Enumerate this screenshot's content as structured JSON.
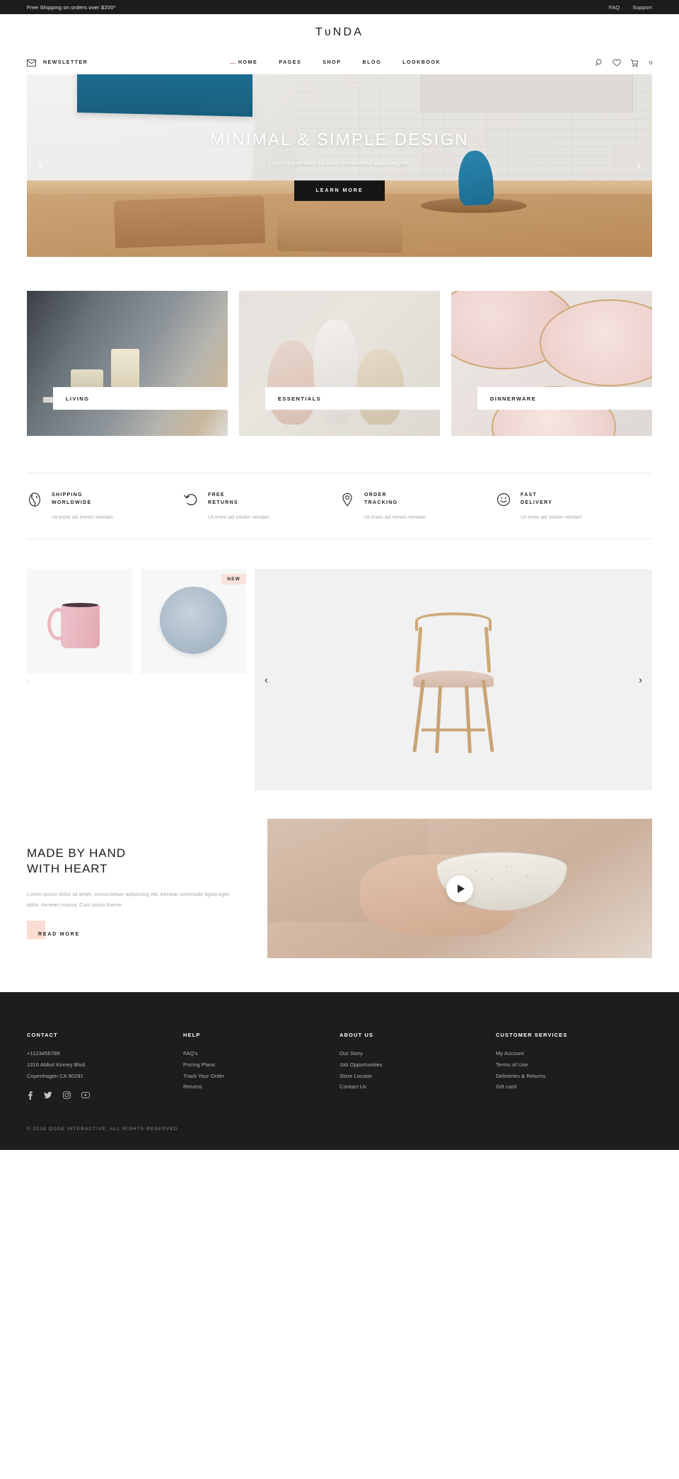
{
  "topbar": {
    "promo": "Free Shipping on orders over $200*",
    "links": [
      "FAQ",
      "Support"
    ]
  },
  "brand": {
    "logo": "TᴜNDA"
  },
  "nav": {
    "newsletter_label": "NEWSLETTER",
    "items": [
      {
        "label": "HOME",
        "active": true
      },
      {
        "label": "PAGES",
        "active": false
      },
      {
        "label": "SHOP",
        "active": false
      },
      {
        "label": "BLOG",
        "active": false
      },
      {
        "label": "LOOKBOOK",
        "active": false
      }
    ],
    "cart_count": "0"
  },
  "hero": {
    "title": "MINIMAL &\nSIMPLE DESIGN",
    "subtitle": "Lorem ipsum dolor sit amet, consectetur adipiscing elit.",
    "cta": "LEARN MORE",
    "prev": "‹",
    "next": "›"
  },
  "categories": [
    {
      "label": "LIVING"
    },
    {
      "label": "ESSENTIALS"
    },
    {
      "label": "DINNERWARE"
    }
  ],
  "services": [
    {
      "icon": "globe-icon",
      "title": "SHIPPING\nWORLDWIDE",
      "desc": "Ut enim ad minim veniam"
    },
    {
      "icon": "return-arrow-icon",
      "title": "FREE\nRETURNS",
      "desc": "Ut enim ad minim veniam"
    },
    {
      "icon": "map-pin-icon",
      "title": "ORDER\nTRACKING",
      "desc": "Ut enim ad minim veniam"
    },
    {
      "icon": "smiley-icon",
      "title": "FAST\nDELIVERY",
      "desc": "Ut enim ad minim veniam"
    }
  ],
  "products": {
    "badge_new": "NEW",
    "stray_text": "y",
    "carousel_prev": "‹",
    "carousel_next": "›"
  },
  "about": {
    "title": "MADE BY HAND\nWITH HEART",
    "desc": "Lorem ipsum dolor sit amet, consectetuer adipiscing elit. Aenean commodo ligula eget dolor. Aenean massa. Cum sociis theme.",
    "cta": "READ MORE"
  },
  "footer": {
    "columns": [
      {
        "heading": "CONTACT",
        "lines": [
          "+1123456789",
          "1316 Abbot Kinney Blvd.",
          "Copenhagen CA 90291"
        ],
        "links": []
      },
      {
        "heading": "HELP",
        "lines": [],
        "links": [
          "FAQ's",
          "Pricing Plans",
          "Track Your Order",
          "Returns"
        ]
      },
      {
        "heading": "ABOUT US",
        "lines": [],
        "links": [
          "Our Story",
          "Job Opportunities",
          "Store Locator",
          "Contact Us"
        ]
      },
      {
        "heading": "CUSTOMER SERVICES",
        "lines": [],
        "links": [
          "My Account",
          "Terms of Use",
          "Deliveries & Returns",
          "Gift card"
        ]
      }
    ],
    "socials": [
      "facebook-icon",
      "twitter-icon",
      "instagram-icon",
      "youtube-icon"
    ],
    "copyright": "© 2018 QODE INTERACTIVE, ALL RIGHTS RESERVED"
  },
  "colors": {
    "dark": "#1d1d1d",
    "accent_pink": "#fbdcd2",
    "badge_bg": "#f9e3dc",
    "nav_active_dash": "#d99a8a"
  }
}
